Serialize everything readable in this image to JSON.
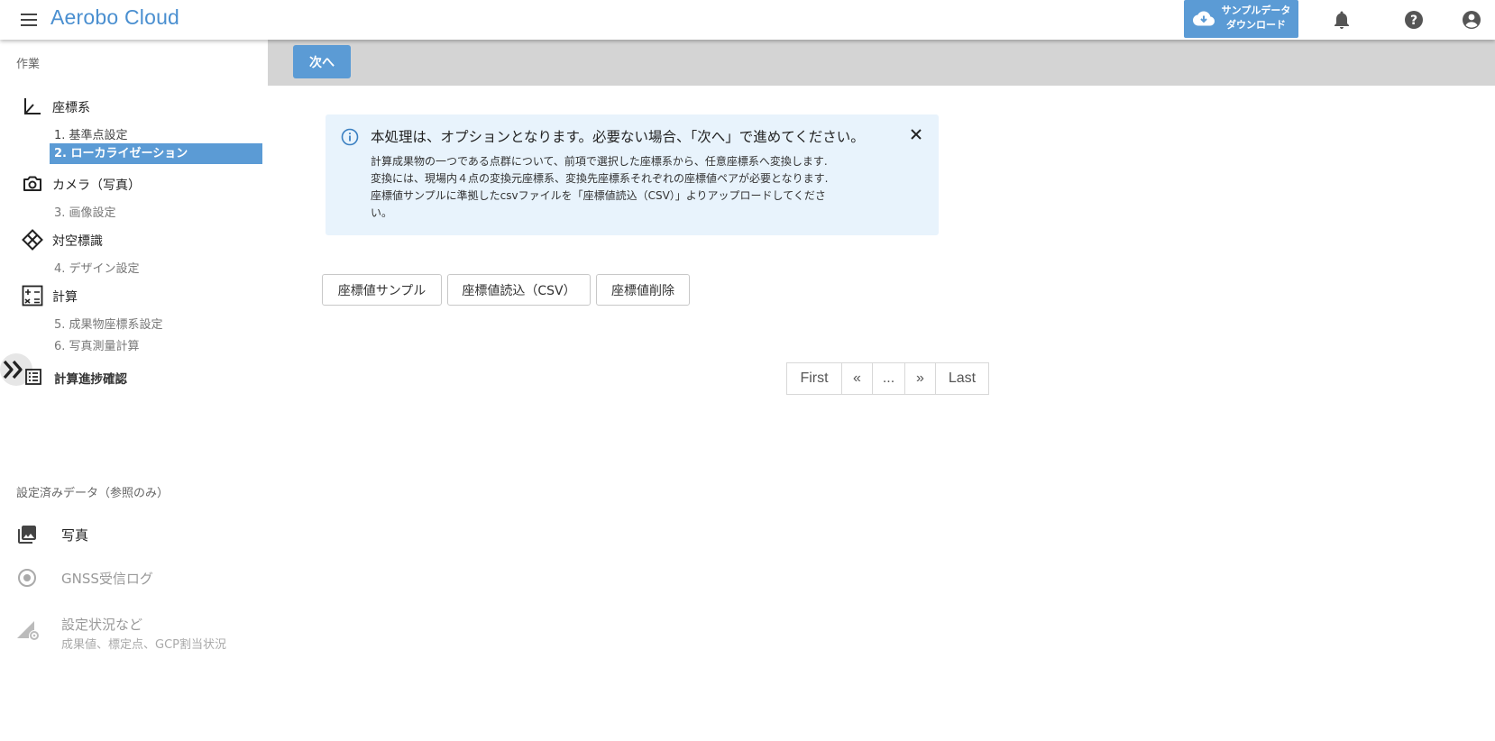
{
  "header": {
    "title": "Aerobo Cloud",
    "download_line1": "サンプルデータ",
    "download_line2": "ダウンロード",
    "icons": [
      "menu-icon",
      "cloud-download-icon",
      "bell-icon",
      "help-icon",
      "account-icon"
    ]
  },
  "sidebar": {
    "work_label": "作業",
    "groups": [
      {
        "label": "座標系",
        "icon": "axes-icon",
        "items": [
          {
            "label": "1. 基準点設定"
          },
          {
            "label": "2. ローカライゼーション"
          }
        ]
      },
      {
        "label": "カメラ（写真）",
        "icon": "camera-icon",
        "items": [
          {
            "label": "3. 画像設定"
          }
        ]
      },
      {
        "label": "対空標識",
        "icon": "target-marker-icon",
        "items": [
          {
            "label": "4. デザイン設定"
          }
        ]
      },
      {
        "label": "計算",
        "icon": "calculator-icon",
        "items": [
          {
            "label": "5. 成果物座標系設定"
          },
          {
            "label": "6. 写真測量計算"
          }
        ]
      }
    ],
    "progress_label": "計算進捗確認",
    "data_section_label": "設定済みデータ（参照のみ）",
    "data_items": [
      {
        "label": "写真",
        "icon": "photo-library-icon"
      },
      {
        "label": "GNSS受信ログ",
        "icon": "radio-target-icon"
      },
      {
        "label": "設定状況など",
        "sub": "成果値、標定点、GCP割当状況",
        "icon": "signal-settings-icon"
      }
    ]
  },
  "main": {
    "next_label": "次へ",
    "info": {
      "title": "本処理は、オプションとなります。必要ない場合、「次へ」で進めてください。",
      "lines": [
        "計算成果物の一つである点群について、前項で選択した座標系から、任意座標系へ変換します.",
        "変換には、現場内４点の変換元座標系、変換先座標系それぞれの座標値ペアが必要となります.",
        "座標値サンプルに準拠したcsvファイルを「座標値読込（CSV）」よりアップロードしてくださ",
        "い。"
      ]
    },
    "buttons": {
      "sample": "座標値サンプル",
      "load_csv": "座標値読込（CSV）",
      "delete": "座標値削除"
    },
    "pagination": {
      "first": "First",
      "prev": "«",
      "ellipsis": "...",
      "next": "»",
      "last": "Last"
    }
  },
  "colors": {
    "accent": "#5b9bd5",
    "title": "#4a8fd0",
    "info_bg": "#e8f3fc",
    "step_bar": "#d4d4d4"
  }
}
